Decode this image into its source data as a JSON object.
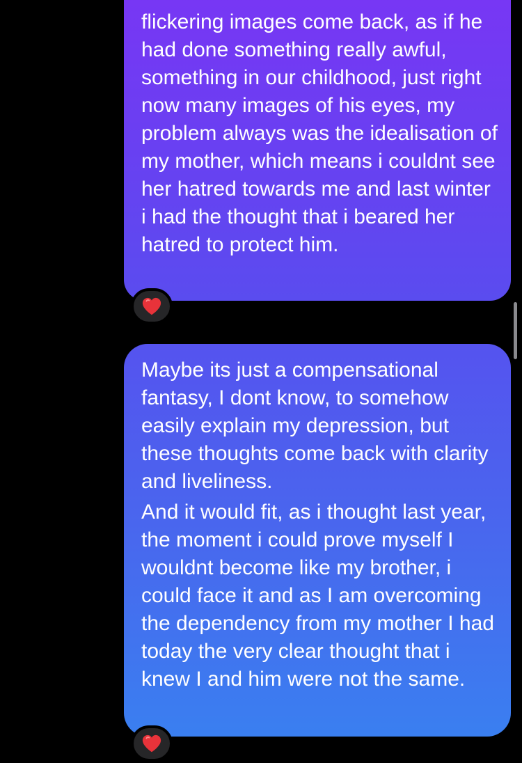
{
  "conversation": {
    "messages": [
      {
        "paragraphs": [
          "flickering images come back, as if he had done something really awful, something in our childhood, just right now many images of his eyes, my problem always was the idealisation of my mother, which means i couldnt see her hatred towards me and last winter i had the thought that i beared her hatred to protect him."
        ],
        "reaction": "heart"
      },
      {
        "paragraphs": [
          "Maybe its just a compensational fantasy, I dont know, to somehow easily explain my depression, but these thoughts come back with clarity and liveliness.",
          "And it would fit, as i thought last year, the moment i could prove myself I wouldnt become like my brother, i could face it and as I am overcoming the dependency from my mother I had today the very clear thought that i knew I and him were not the same."
        ],
        "reaction": "heart"
      }
    ]
  },
  "colors": {
    "background": "#000000",
    "bubble_top": "#7a35f4",
    "bubble_bottom": "#3a7ff0",
    "reaction_bg": "#262628",
    "heart": "#e8333a"
  }
}
